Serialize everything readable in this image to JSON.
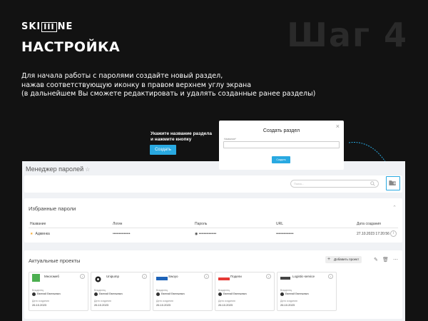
{
  "logo": {
    "pre": "SKI",
    "boxed": "III",
    "post": "NE"
  },
  "step_label": "Шаг 4",
  "heading": "НАСТРОЙКА",
  "intro": [
    "Для начала работы с паролями создайте новый раздел,",
    "нажав соответствующую иконку в правом верхнем углу экрана",
    "(в дальнейшем Вы сможете редактировать и удалять созданные ранее разделы)"
  ],
  "hint": {
    "line1": "Укажите название раздела",
    "line2": "и нажмите кнопку",
    "button": "Создать"
  },
  "modal": {
    "close": "×",
    "title": "Создать раздел",
    "field_label": "Название*",
    "save": "Создать"
  },
  "app": {
    "title": "Менеджер паролей",
    "star": "☆",
    "search_placeholder": "Поиск...",
    "favorites": {
      "title": "Избранные пароли",
      "columns": [
        "Название",
        "Логин",
        "Пароль",
        "URL",
        "Дата создания"
      ],
      "rows": [
        {
          "name": "Админка",
          "login": "••••••••••••••",
          "password": "••••••••••••••",
          "url": "••••••••••••••",
          "date": "27.10.2023 17:20:56"
        }
      ]
    },
    "projects": {
      "title": "Актуальные проекты",
      "add_button": "Добавить проект",
      "owner_label": "Владелец",
      "date_label": "Дата создания",
      "cards": [
        {
          "name": "Многомеб",
          "owner": "Евгений Евгеньевич",
          "date": "26.10.2023",
          "logo_color": "#4caf50"
        },
        {
          "name": "Unipump",
          "owner": "Евгений Евгеньевич",
          "date": "26.10.2023",
          "logo_color": "#222222"
        },
        {
          "name": "Swoyo",
          "owner": "Евгений Евгеньевич",
          "date": "26.10.2023",
          "logo_color": "#1e63b8"
        },
        {
          "name": "Подели",
          "owner": "Евгений Евгеньевич",
          "date": "26.10.2023",
          "logo_color": "#e53935"
        },
        {
          "name": "Logistic-service",
          "owner": "Евгений Евгеньевич",
          "date": "26.10.2023",
          "logo_color": "#444444"
        }
      ]
    }
  },
  "colors": {
    "background": "#121212",
    "accent": "#29a9e1",
    "panel": "#ffffff",
    "app_bg": "#f0f2f5",
    "star": "#f5a623"
  },
  "icons": [
    "folder-plus-icon",
    "search-icon",
    "close-icon",
    "star-icon",
    "info-icon",
    "edit-icon",
    "trash-icon",
    "more-icon",
    "chevron-up-icon",
    "arrow-icon"
  ]
}
